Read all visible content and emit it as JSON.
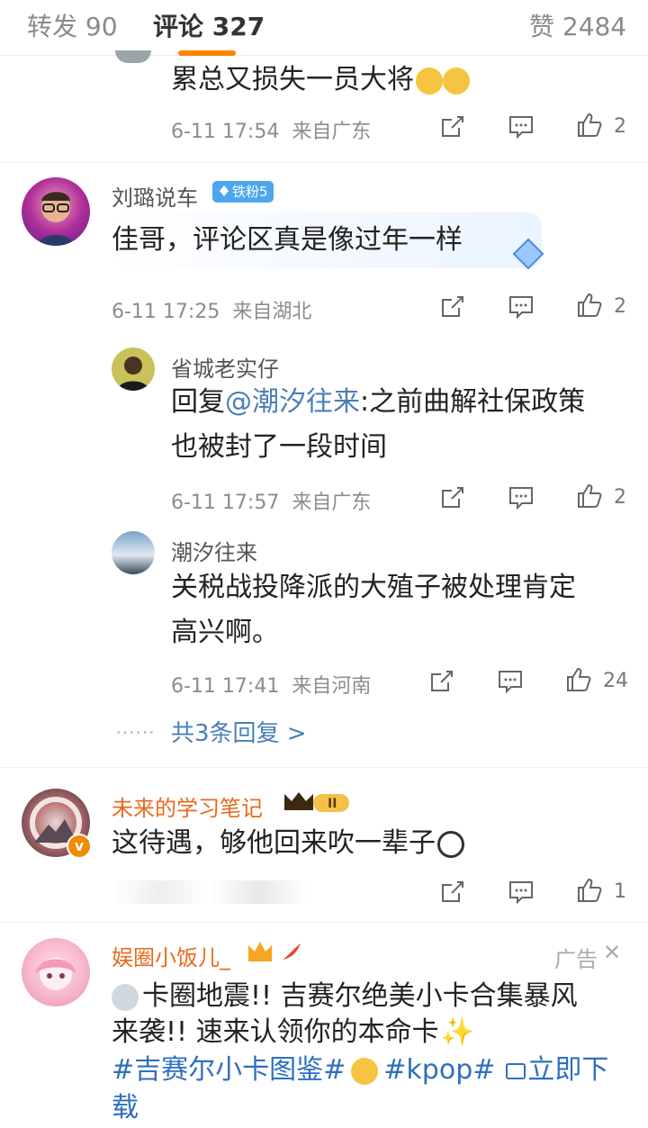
{
  "tabs": {
    "repost": "转发 90",
    "comments": "评论 327",
    "likes": "赞 2484"
  },
  "c0": {
    "text": "累总又损失一员大将",
    "time": "6-11 17:54",
    "loc": "来自广东",
    "likes": "2"
  },
  "c1": {
    "name": "刘璐说车",
    "badge": "铁粉5",
    "text": "佳哥，评论区真是像过年一样",
    "time": "6-11 17:25",
    "loc": "来自湖北",
    "likes": "2"
  },
  "r1": {
    "name": "省城老实仔",
    "reply_prefix": "回复",
    "mention": "@潮汐往来",
    "text1": ":之前曲解社保政策",
    "text2": "也被封了一段时间",
    "time": "6-11 17:57",
    "loc": "来自广东",
    "likes": "2"
  },
  "r2": {
    "name": "潮汐往来",
    "text1": "关税战投降派的大殖子被处理肯定",
    "text2": "高兴啊。",
    "time": "6-11 17:41",
    "loc": "来自河南",
    "likes": "24"
  },
  "more": {
    "dots": "……",
    "label": "共3条回复 >"
  },
  "c2": {
    "name": "未来的学习笔记",
    "text": "这待遇，够他回来吹一辈子",
    "likes": "1"
  },
  "ad": {
    "name": "娱圈小饭儿_",
    "ad_label": "广告",
    "close": "✕",
    "line1": "卡圈地震!! 吉赛尔绝美小卡合集暴风",
    "line2": "来袭!! 速来认领你的本命卡",
    "tag1": "#吉赛尔小卡图鉴#",
    "tag2": "#kpop#",
    "download": "立即下",
    "download2": "载"
  },
  "colors": {
    "accent": "#ff8200",
    "link": "#4a7fb8",
    "vip_name": "#e86a1f"
  }
}
